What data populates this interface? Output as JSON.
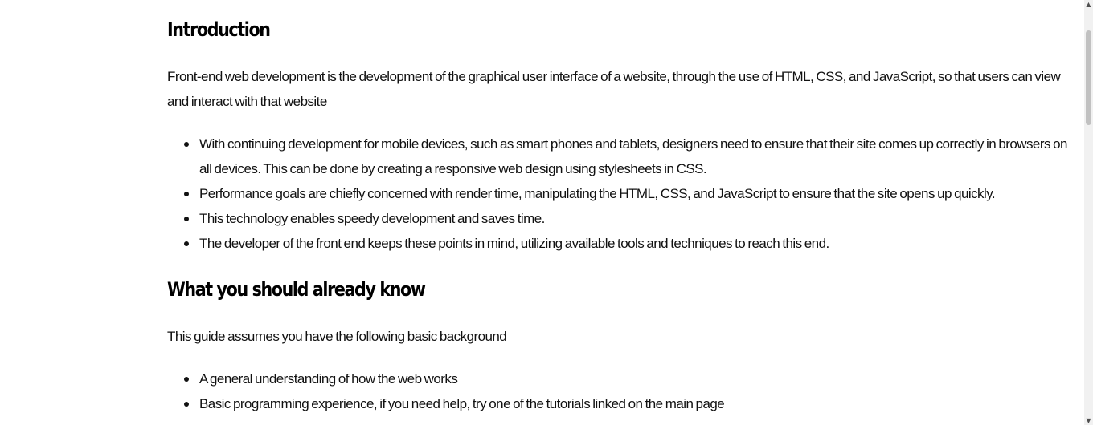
{
  "intro": {
    "heading": "Introduction",
    "paragraph": "Front-end web development is the development of the graphical user interface of a website, through the use of HTML, CSS, and JavaScript, so that users can view and interact with that website",
    "bullets": [
      "With continuing development for mobile devices, such as smart phones and tablets, designers need to ensure that their site comes up correctly in browsers on all devices. This can be done by creating a responsive web design using stylesheets in CSS.",
      "Performance goals are chiefly concerned with render time, manipulating the HTML, CSS, and JavaScript to ensure that the site opens up quickly.",
      "This technology enables speedy development and saves time.",
      "The developer of the front end keeps these points in mind, utilizing available tools and techniques to reach this end."
    ]
  },
  "prereq": {
    "heading": "What you should already know",
    "paragraph": "This guide assumes you have the following basic background",
    "bullets": [
      "A general understanding of how the web works",
      "Basic programming experience, if you need help, try one of the tutorials linked on the main page"
    ]
  },
  "scrollbar": {
    "up_icon": "▲",
    "down_icon": "▼"
  }
}
